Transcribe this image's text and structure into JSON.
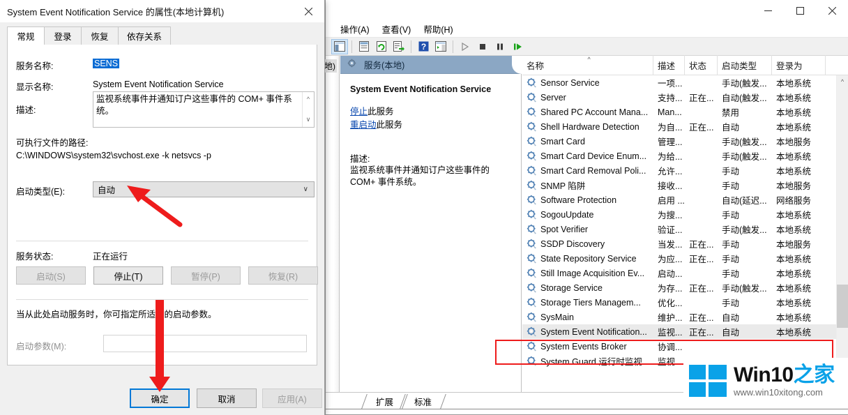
{
  "dialog": {
    "title": "System Event Notification Service 的属性(本地计算机)",
    "close_icon": "close-icon",
    "tabs": [
      {
        "label": "常规",
        "active": true
      },
      {
        "label": "登录",
        "active": false
      },
      {
        "label": "恢复",
        "active": false
      },
      {
        "label": "依存关系",
        "active": false
      }
    ],
    "fields": {
      "service_name_label": "服务名称:",
      "service_name_value": "SENS",
      "display_name_label": "显示名称:",
      "display_name_value": "System Event Notification Service",
      "description_label": "描述:",
      "description_value": "监视系统事件并通知订户这些事件的 COM+ 事件系统。",
      "exe_path_label": "可执行文件的路径:",
      "exe_path_value": "C:\\WINDOWS\\system32\\svchost.exe -k netsvcs -p",
      "startup_type_label": "启动类型(E):",
      "startup_type_value": "自动",
      "service_status_label": "服务状态:",
      "service_status_value": "正在运行",
      "params_note": "当从此处启动服务时，你可指定所适用的启动参数。",
      "params_label": "启动参数(M):",
      "params_value": ""
    },
    "control_buttons": [
      {
        "label": "启动(S)",
        "enabled": false
      },
      {
        "label": "停止(T)",
        "enabled": true
      },
      {
        "label": "暂停(P)",
        "enabled": false
      },
      {
        "label": "恢复(R)",
        "enabled": false
      }
    ],
    "footer_buttons": [
      {
        "label": "确定",
        "state": "default"
      },
      {
        "label": "取消",
        "state": "normal"
      },
      {
        "label": "应用(A)",
        "state": "disabled"
      }
    ]
  },
  "mmc": {
    "caption_buttons": [
      {
        "name": "minimize-button",
        "glyph": "minimize-icon"
      },
      {
        "name": "maximize-button",
        "glyph": "maximize-icon"
      },
      {
        "name": "close-button",
        "glyph": "close-icon"
      }
    ],
    "menus": [
      "操作(A)",
      "查看(V)",
      "帮助(H)"
    ],
    "toolbar_icons": [
      "show-hide-tree-icon",
      "properties-icon",
      "refresh-icon",
      "export-list-icon",
      "help-icon",
      "show-action-pane-icon",
      "start-service-icon",
      "stop-service-icon",
      "pause-service-icon",
      "restart-service-icon"
    ],
    "tree_node_label": "本地)",
    "pane_header": {
      "icon": "services-gear-icon",
      "title": "服务(本地)"
    },
    "detail": {
      "service_title": "System Event Notification Service",
      "links": [
        {
          "link_text": "停止",
          "tail": "此服务"
        },
        {
          "link_text": "重启动",
          "tail": "此服务"
        }
      ],
      "description_label": "描述:",
      "description_text": "监视系统事件并通知订户这些事件的 COM+ 事件系统。"
    },
    "list": {
      "columns": [
        "名称",
        "描述",
        "状态",
        "启动类型",
        "登录为"
      ],
      "sort_column": "名称",
      "sort_direction": "asc",
      "rows": [
        {
          "name": "Sensor Service",
          "desc": "一项...",
          "status": "",
          "startup": "手动(触发...",
          "logon": "本地系统",
          "selected": false
        },
        {
          "name": "Server",
          "desc": "支持...",
          "status": "正在...",
          "startup": "自动(触发...",
          "logon": "本地系统",
          "selected": false
        },
        {
          "name": "Shared PC Account Mana...",
          "desc": "Man...",
          "status": "",
          "startup": "禁用",
          "logon": "本地系统",
          "selected": false
        },
        {
          "name": "Shell Hardware Detection",
          "desc": "为自...",
          "status": "正在...",
          "startup": "自动",
          "logon": "本地系统",
          "selected": false
        },
        {
          "name": "Smart Card",
          "desc": "管理...",
          "status": "",
          "startup": "手动(触发...",
          "logon": "本地服务",
          "selected": false
        },
        {
          "name": "Smart Card Device Enum...",
          "desc": "为给...",
          "status": "",
          "startup": "手动(触发...",
          "logon": "本地系统",
          "selected": false
        },
        {
          "name": "Smart Card Removal Poli...",
          "desc": "允许...",
          "status": "",
          "startup": "手动",
          "logon": "本地系统",
          "selected": false
        },
        {
          "name": "SNMP 陷阱",
          "desc": "接收...",
          "status": "",
          "startup": "手动",
          "logon": "本地服务",
          "selected": false
        },
        {
          "name": "Software Protection",
          "desc": "启用 ...",
          "status": "",
          "startup": "自动(延迟...",
          "logon": "网络服务",
          "selected": false
        },
        {
          "name": "SogouUpdate",
          "desc": "为搜...",
          "status": "",
          "startup": "手动",
          "logon": "本地系统",
          "selected": false
        },
        {
          "name": "Spot Verifier",
          "desc": "验证...",
          "status": "",
          "startup": "手动(触发...",
          "logon": "本地系统",
          "selected": false
        },
        {
          "name": "SSDP Discovery",
          "desc": "当发...",
          "status": "正在...",
          "startup": "手动",
          "logon": "本地服务",
          "selected": false
        },
        {
          "name": "State Repository Service",
          "desc": "为应...",
          "status": "正在...",
          "startup": "手动",
          "logon": "本地系统",
          "selected": false
        },
        {
          "name": "Still Image Acquisition Ev...",
          "desc": "启动...",
          "status": "",
          "startup": "手动",
          "logon": "本地系统",
          "selected": false
        },
        {
          "name": "Storage Service",
          "desc": "为存...",
          "status": "正在...",
          "startup": "手动(触发...",
          "logon": "本地系统",
          "selected": false
        },
        {
          "name": "Storage Tiers Managem...",
          "desc": "优化...",
          "status": "",
          "startup": "手动",
          "logon": "本地系统",
          "selected": false
        },
        {
          "name": "SysMain",
          "desc": "维护...",
          "status": "正在...",
          "startup": "自动",
          "logon": "本地系统",
          "selected": false
        },
        {
          "name": "System Event Notification...",
          "desc": "监视...",
          "status": "正在...",
          "startup": "自动",
          "logon": "本地系统",
          "selected": true
        },
        {
          "name": "System Events Broker",
          "desc": "协调...",
          "status": "",
          "startup": "",
          "logon": "",
          "selected": false
        },
        {
          "name": "System Guard 运行时监视",
          "desc": "监视",
          "status": "",
          "startup": "",
          "logon": "",
          "selected": false
        }
      ]
    },
    "bottom_tabs": [
      {
        "label": "扩展",
        "active": false
      },
      {
        "label": "标准",
        "active": true
      }
    ]
  },
  "watermark": {
    "brand_black": "Win10",
    "brand_blue": "之家",
    "url": "www.win10xitong.com",
    "logo_icon": "windows-logo-icon"
  },
  "annotations": {
    "arrow_color": "#ee1c1c",
    "highlight_box_color": "#ee1c1c",
    "arrows": [
      {
        "name": "arrow-to-startup-type"
      },
      {
        "name": "arrow-to-ok-button"
      }
    ]
  },
  "colors": {
    "accent": "#0078d7",
    "selection": "#0b6cd4",
    "pane_header": "#8ba7c4",
    "annotation_red": "#ee1c1c",
    "brand_blue": "#0aa2e8"
  }
}
